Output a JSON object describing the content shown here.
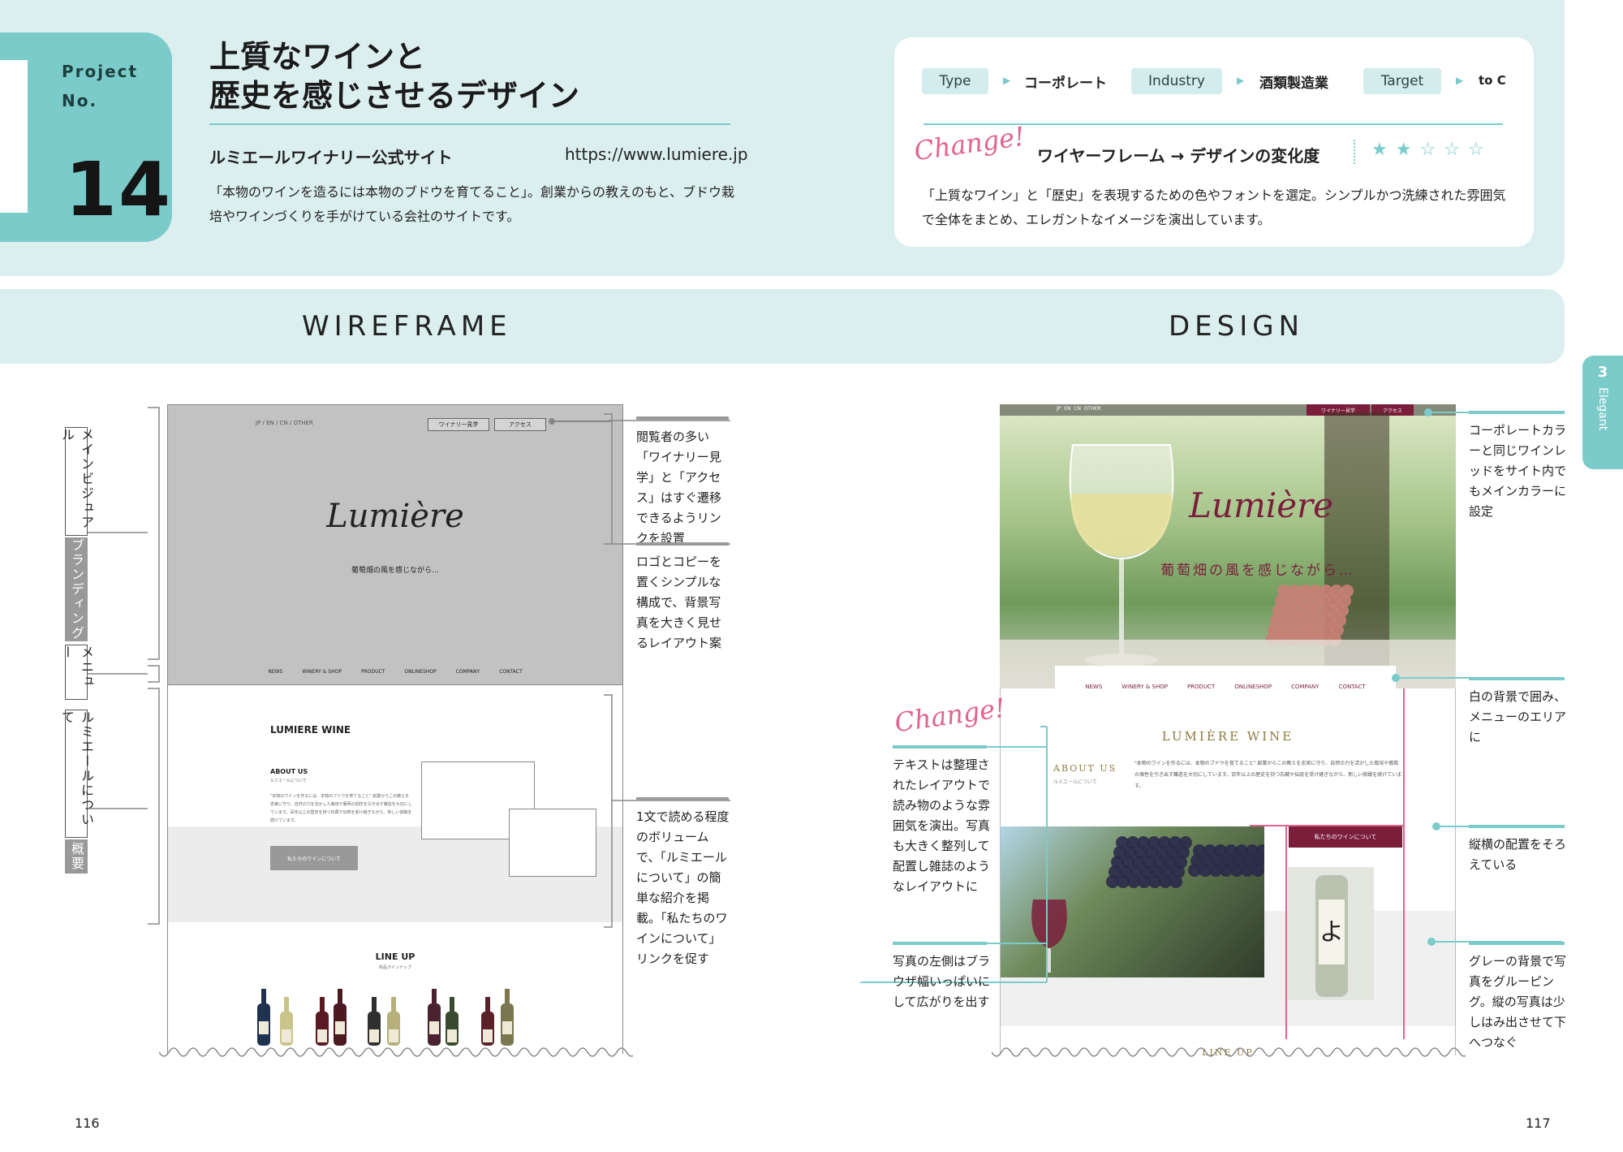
{
  "project": {
    "label_top": "Project",
    "label_bottom": "No.",
    "number": "14"
  },
  "title": {
    "line1": "上質なワインと",
    "line2": "歴史を感じさせるデザイン"
  },
  "site_name": "ルミエールワイナリー公式サイト",
  "site_url": "https://www.lumiere.jp",
  "description": "「本物のワインを造るには本物のブドウを育てること」。創業からの教えのもと、ブドウ栽培やワインづくりを手がけている会社のサイトです。",
  "tags": [
    {
      "label": "Type",
      "value": "コーポレート"
    },
    {
      "label": "Industry",
      "value": "酒類製造業"
    },
    {
      "label": "Target",
      "value": "to C"
    }
  ],
  "change": {
    "word": "Change!",
    "text": "ワイヤーフレーム → デザインの変化度",
    "stars": "★★☆☆☆",
    "stars_level": 2,
    "stars_max": 5,
    "description": "「上質なワイン」と「歴史」を表現するための色やフォントを選定。シンプルかつ洗練された雰囲気で全体をまとめ、エレガントなイメージを演出しています。"
  },
  "sections": {
    "left": "WIREFRAME",
    "right": "DESIGN"
  },
  "side_tab": {
    "number": "3",
    "label": "Elegant"
  },
  "colors": {
    "teal": "#7bcbcb",
    "light_teal": "#dcefef",
    "wine": "#7a1e3c",
    "pink": "#e2638b"
  },
  "wireframe": {
    "labels": {
      "main_visual": "メインビジュアル",
      "branding": "ブランディング",
      "menu": "メニュー",
      "about": "ルミエールについて",
      "summary": "概要"
    },
    "lang": "JP / EN / CN / OTHER",
    "btn1": "ワイナリー見学",
    "btn2": "アクセス",
    "logo": "Lumière",
    "copy": "葡萄畑の風を感じながら…",
    "nav": [
      "NEWS",
      "WINERY & SHOP",
      "PRODUCT",
      "ONLINESHOP",
      "COMPANY",
      "CONTACT"
    ],
    "heading": "LUMIERE WINE",
    "about_title": "ABOUT US",
    "about_sub": "ルミエールについて",
    "about_text": "\"本物のワインを作るには、本物のブドウを育てること\" 創業からこの教えを忠実に守り、自然の力を活かした栽培や葡萄の個性を引き出す醸造を大切にしています。百年以上の歴史を持つ石蔵や伝統を受け継ぎながら、新しい挑戦を続けています。",
    "about_btn": "私たちのワインについて",
    "lineup": "LINE UP",
    "lineup_sub": "商品ラインナップ",
    "annotations": [
      "閲覧者の多い「ワイナリー見学」と「アクセス」はすぐ遷移できるようリンクを設置",
      "ロゴとコピーを置くシンプルな構成で、背景写真を大きく見せるレイアウト案",
      "1文で読める程度のボリュームで、「ルミエールについて」の簡単な紹介を掲載。「私たちのワインについて」リンクを促す"
    ]
  },
  "design": {
    "lang": [
      "JP",
      "EN",
      "CN",
      "OTHER"
    ],
    "btn1": "ワイナリー見学",
    "btn2": "アクセス",
    "logo": "Lumière",
    "copy": "葡萄畑の風を感じながら…",
    "nav": [
      "NEWS",
      "WINERY & SHOP",
      "PRODUCT",
      "ONLINESHOP",
      "COMPANY",
      "CONTACT"
    ],
    "heading": "LUMIÈRE WINE",
    "about_title": "ABOUT US",
    "about_sub": "ルミエールについて",
    "about_text": "\"本物のワインを作るには、本物のブドウを育てること\" 創業からこの教えを忠実に守り、自然の力を活かした栽培や葡萄の個性を引き出す醸造を大切にしています。百年以上の歴史を持つ石蔵や伝統を受け継ぎながら、新しい挑戦を続けています。",
    "about_btn": "私たちのワインについて",
    "lineup": "LINE UP",
    "change_word": "Change!",
    "annotations_right": [
      "コーポレートカラーと同じワインレッドをサイト内でもメインカラーに設定",
      "白の背景で囲み、メニューのエリアに",
      "縦横の配置をそろえている",
      "グレーの背景で写真をグルーピング。縦の写真は少しはみ出させて下へつなぐ"
    ],
    "annotations_left": [
      "テキストは整理されたレイアウトで読み物のような雰囲気を演出。写真も大きく整列して配置し雑誌のようなレイアウトに",
      "写真の左側はブラウザ幅いっぱいにして広がりを出す"
    ]
  },
  "pages": {
    "left": "116",
    "right": "117"
  }
}
